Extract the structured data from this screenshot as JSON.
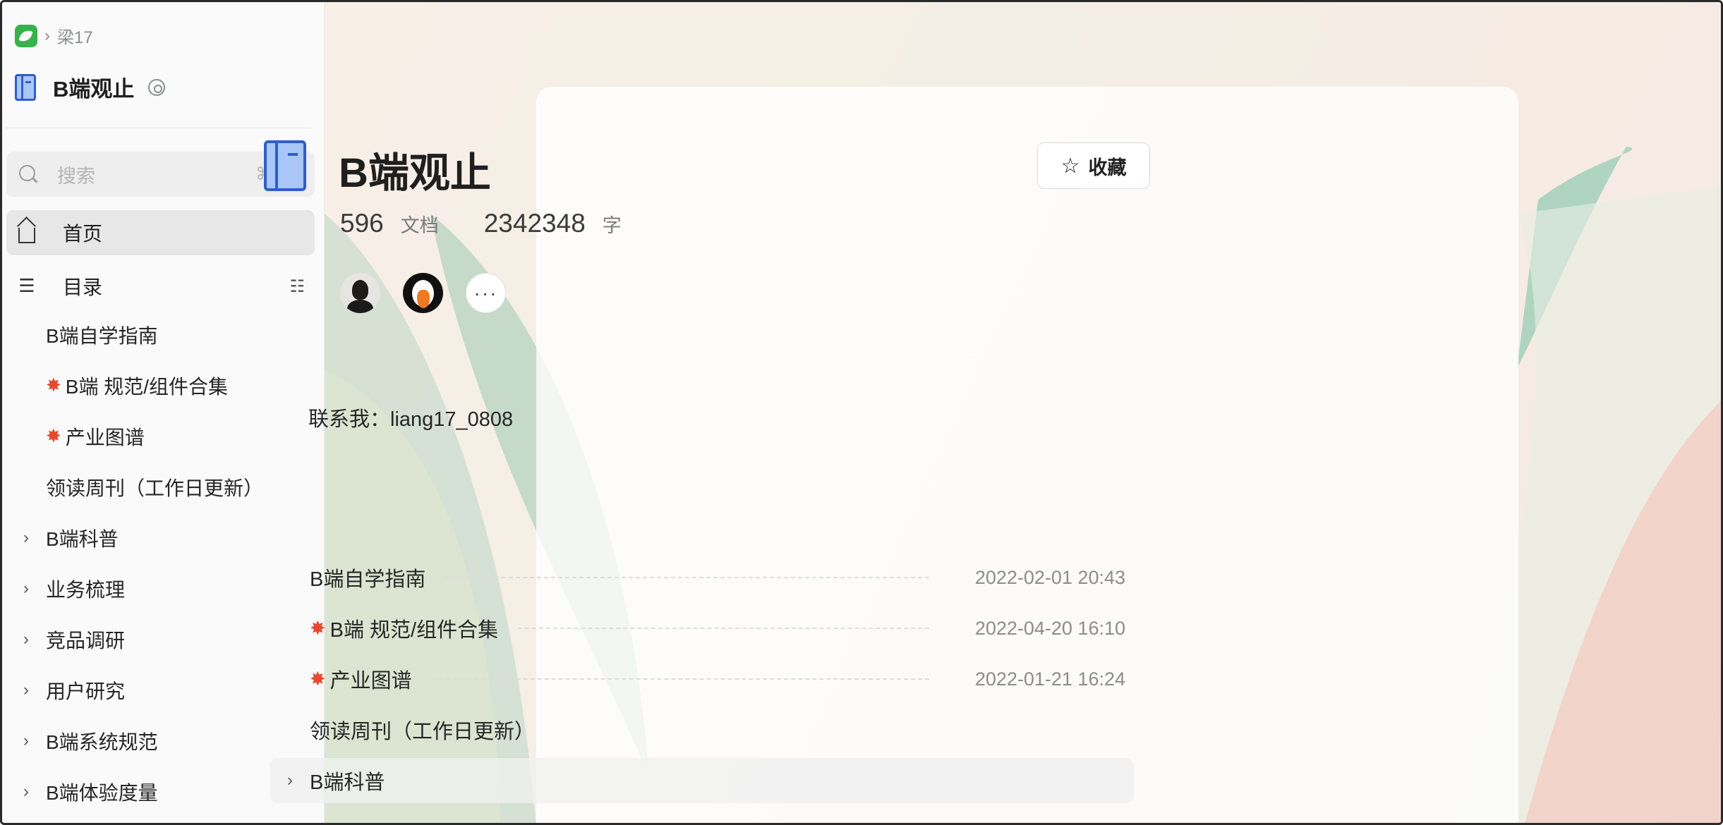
{
  "breadcrumb": {
    "text": "梁17"
  },
  "space": {
    "name": "B端观止"
  },
  "search": {
    "placeholder": "搜索",
    "shortcut": "⌘ + J"
  },
  "nav": {
    "home": "首页",
    "toc": "目录"
  },
  "sidebar_tree": [
    {
      "label": "B端自学指南",
      "emoji": "",
      "expandable": false
    },
    {
      "label": "B端 规范/组件合集",
      "emoji": "✸",
      "expandable": false
    },
    {
      "label": "产业图谱",
      "emoji": "✸",
      "expandable": false
    },
    {
      "label": "领读周刊（工作日更新）",
      "emoji": "",
      "expandable": false
    },
    {
      "label": "B端科普",
      "emoji": "",
      "expandable": true
    },
    {
      "label": "业务梳理",
      "emoji": "",
      "expandable": true
    },
    {
      "label": "竞品调研",
      "emoji": "",
      "expandable": true
    },
    {
      "label": "用户研究",
      "emoji": "",
      "expandable": true
    },
    {
      "label": "B端系统规范",
      "emoji": "",
      "expandable": true
    },
    {
      "label": "B端体验度量",
      "emoji": "",
      "expandable": true
    }
  ],
  "main": {
    "title": "B端观止",
    "favorite_label": "收藏",
    "stats": {
      "docs_count": "596",
      "docs_unit": "文档",
      "words_count": "2342348",
      "words_unit": "字"
    },
    "more_label": "···",
    "contact": "联系我：liang17_0808",
    "docs": [
      {
        "title": "B端自学指南",
        "emoji": "",
        "time": "2022-02-01 20:43"
      },
      {
        "title": "B端 规范/组件合集",
        "emoji": "✸",
        "time": "2022-04-20 16:10"
      },
      {
        "title": "产业图谱",
        "emoji": "✸",
        "time": "2022-01-21 16:24"
      },
      {
        "title": "领读周刊（工作日更新）",
        "emoji": "",
        "time": ""
      },
      {
        "title": "B端科普",
        "emoji": "",
        "time": ""
      }
    ]
  },
  "colors": {
    "accent_blue": "#2f5ec9",
    "brand_green": "#35b24a",
    "burst_red": "#e5492f"
  },
  "icons": [
    "app-logo-icon",
    "chevron-right-icon",
    "book-icon",
    "settings-icon",
    "search-icon",
    "home-icon",
    "toc-icon",
    "star-icon"
  ]
}
